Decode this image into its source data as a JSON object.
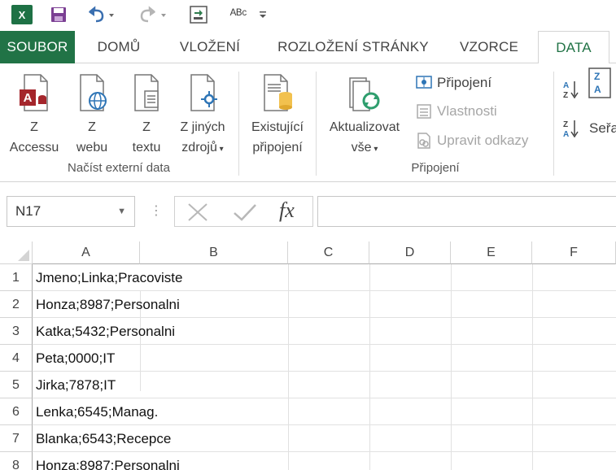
{
  "qat": {
    "app_logo": "X",
    "abc_text": "ᴬᴮᶜ"
  },
  "tabs": [
    {
      "label": "SOUBOR"
    },
    {
      "label": "DOMŮ"
    },
    {
      "label": "VLOŽENÍ"
    },
    {
      "label": "ROZLOŽENÍ STRÁNKY"
    },
    {
      "label": "VZORCE"
    },
    {
      "label": "DATA"
    }
  ],
  "ribbon": {
    "external": {
      "access": [
        "Z",
        "Accessu"
      ],
      "web": [
        "Z",
        "webu"
      ],
      "text": [
        "Z",
        "textu"
      ],
      "other": [
        "Z jiných",
        "zdrojů"
      ],
      "group_label": "Načíst externí data"
    },
    "existing": [
      "Existující",
      "připojení"
    ],
    "refresh": [
      "Aktualizovat",
      "vše"
    ],
    "connections": {
      "connections_label": "Připojení",
      "properties_label": "Vlastnosti",
      "edit_links_label": "Upravit odkazy",
      "group_label": "Připojení"
    },
    "sort": {
      "sort_label": "Seřa"
    }
  },
  "formula_bar": {
    "name_box": "N17",
    "fx": "fx",
    "value": ""
  },
  "grid": {
    "columns": [
      "A",
      "B",
      "C",
      "D",
      "E",
      "F"
    ],
    "rows": [
      {
        "num": "1",
        "a": "Jmeno;Linka;Pracoviste"
      },
      {
        "num": "2",
        "a": "Honza;8987;Personalni"
      },
      {
        "num": "3",
        "a": "Katka;5432;Personalni"
      },
      {
        "num": "4",
        "a": "Peta;0000;IT"
      },
      {
        "num": "5",
        "a": "Jirka;7878;IT"
      },
      {
        "num": "6",
        "a": "Lenka;6545;Manag."
      },
      {
        "num": "7",
        "a": "Blanka;6543;Recepce"
      },
      {
        "num": "8",
        "a": "Honza;8987;Personalni"
      }
    ]
  },
  "colors": {
    "brand_green": "#217346",
    "excel_logo": "#1e7145",
    "save_purple": "#7b3f93"
  }
}
